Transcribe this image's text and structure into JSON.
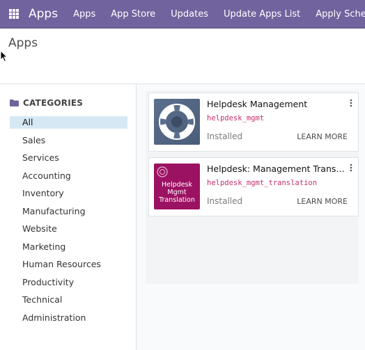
{
  "navbar": {
    "brand": "Apps",
    "menu": [
      "Apps",
      "App Store",
      "Updates",
      "Update Apps List",
      "Apply Scheduled Upgrades"
    ]
  },
  "control_panel": {
    "breadcrumb": "Apps"
  },
  "sidebar": {
    "header": "CATEGORIES",
    "categories": [
      "All",
      "Sales",
      "Services",
      "Accounting",
      "Inventory",
      "Manufacturing",
      "Website",
      "Marketing",
      "Human Resources",
      "Productivity",
      "Technical",
      "Administration"
    ],
    "active": "All"
  },
  "apps": [
    {
      "title": "Helpdesk Management",
      "technical_name": "helpdesk_mgmt",
      "status": "Installed",
      "action": "LEARN MORE",
      "icon": "lifebuoy-icon"
    },
    {
      "title": "Helpdesk: Management Translation",
      "technical_name": "helpdesk_mgmt_translation",
      "status": "Installed",
      "action": "LEARN MORE",
      "icon": "helpdesk-translation-icon",
      "icon_text": [
        "Helpdesk",
        "Mgmt",
        "Translation"
      ]
    }
  ],
  "colors": {
    "navbar": "#71639e",
    "active_category": "#d7e8f5",
    "technical_name": "#c7306e",
    "app1_icon_bg": "#5a6f8e",
    "app2_icon_bg": "#9c1263"
  }
}
